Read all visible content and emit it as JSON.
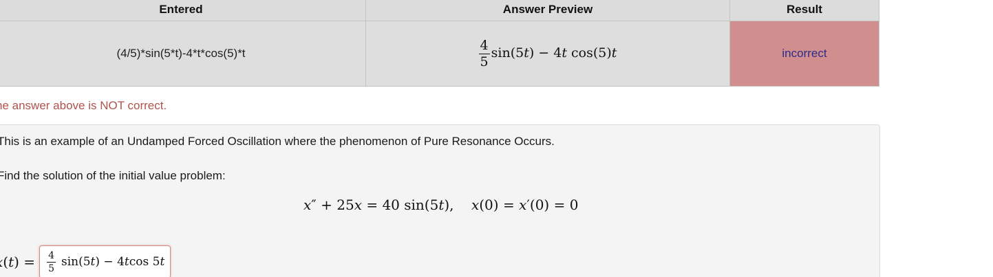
{
  "results_table": {
    "headers": [
      "Entered",
      "Answer Preview",
      "Result"
    ],
    "row": {
      "entered": "(4/5)*sin(5*t)-4*t*cos(5)*t",
      "preview": {
        "frac_num": "4",
        "frac_den": "5",
        "rest_parts": [
          "sin(5",
          "t",
          ") − 4",
          "t",
          " cos(5)",
          "t"
        ]
      },
      "result": "incorrect"
    },
    "colors": {
      "incorrect_bg": "#d08e8e",
      "incorrect_text": "#2a2d8a"
    }
  },
  "feedback": {
    "message": "he answer above is NOT correct.",
    "color": "#b0524d"
  },
  "problem": {
    "intro": "This is an example of an Undamped Forced Oscillation where the phenomenon of Pure Resonance Occurs.",
    "find": "Find the solution of the initial value problem:",
    "equation_parts": [
      "x",
      "″ + 25",
      "x",
      " = 40 sin(5",
      "t",
      "),    ",
      "x",
      "(0) = ",
      "x",
      "′(0) = 0"
    ],
    "answer_label_parts": [
      "x",
      "(",
      "t",
      ") ="
    ],
    "answer_input": {
      "frac_num": "4",
      "frac_den": "5",
      "rest_parts": [
        "sin(5",
        "t",
        ") − 4",
        "t",
        " cos 5",
        "t"
      ]
    }
  }
}
